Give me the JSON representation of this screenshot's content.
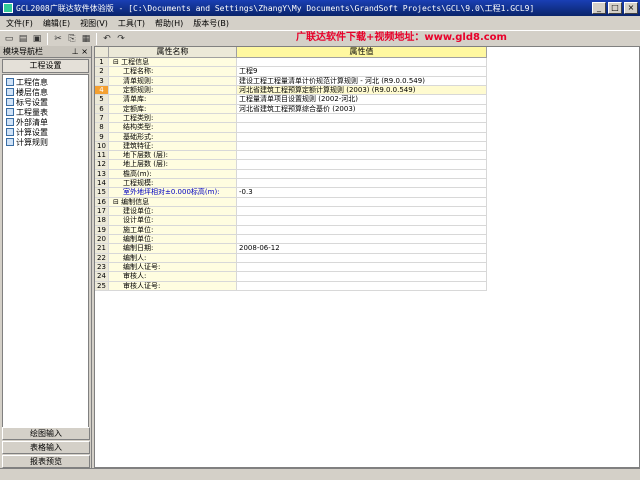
{
  "window": {
    "title": "GCL2008广联达软件体验版 - [C:\\Documents and Settings\\ZhangY\\My Documents\\GrandSoft Projects\\GCL\\9.0\\工程1.GCL9]",
    "minimize": "_",
    "maximize": "□",
    "close": "×"
  },
  "menu": [
    "文件(F)",
    "编辑(E)",
    "视图(V)",
    "工具(T)",
    "帮助(H)",
    "版本号(B)"
  ],
  "toolbar": {
    "icons": [
      "new-icon",
      "open-icon",
      "save-icon",
      "cut-icon",
      "copy-icon",
      "paste-icon",
      "undo-icon",
      "redo-icon"
    ],
    "glyphs": [
      "▭",
      "▤",
      "▣",
      "✂",
      "⎘",
      "▦",
      "↶",
      "↷"
    ]
  },
  "banner": "广联达软件下载+视频地址：www.gld8.com",
  "sidebar": {
    "title": "模块导航栏",
    "pin": "⊥ ×",
    "tab": "工程设置",
    "items": [
      "工程信息",
      "楼层信息",
      "标号设置",
      "工程量表",
      "外部清单",
      "计算设置",
      "计算规则"
    ],
    "bottom": [
      "绘图输入",
      "表格输入",
      "报表预览"
    ]
  },
  "grid": {
    "headers": [
      "",
      "属性名称",
      "属性值"
    ],
    "rows": [
      {
        "n": "1",
        "name": "⊟ 工程信息",
        "value": "",
        "group": true
      },
      {
        "n": "2",
        "name": "工程名称:",
        "value": "工程9"
      },
      {
        "n": "3",
        "name": "清单规则:",
        "value": "建设工程工程量清单计价规范计算规则 - 河北 (R9.0.0.549)"
      },
      {
        "n": "4",
        "name": "定额规则:",
        "value": "河北省建筑工程预算定额计算规则 (2003) (R9.0.0.549)",
        "hi": true
      },
      {
        "n": "5",
        "name": "清单库:",
        "value": "工程量清单项目设置规则 (2002-河北)"
      },
      {
        "n": "6",
        "name": "定额库:",
        "value": "河北省建筑工程预算综合基价 (2003)"
      },
      {
        "n": "7",
        "name": "工程类别:",
        "value": ""
      },
      {
        "n": "8",
        "name": "结构类型:",
        "value": ""
      },
      {
        "n": "9",
        "name": "基础形式:",
        "value": ""
      },
      {
        "n": "10",
        "name": "建筑特征:",
        "value": ""
      },
      {
        "n": "11",
        "name": "地下层数 (层):",
        "value": ""
      },
      {
        "n": "12",
        "name": "地上层数 (层):",
        "value": ""
      },
      {
        "n": "13",
        "name": "檐高(m):",
        "value": ""
      },
      {
        "n": "14",
        "name": "工程规模:",
        "value": ""
      },
      {
        "n": "15",
        "name": "室外地坪相对±0.000标高(m):",
        "value": "-0.3",
        "blue": true
      },
      {
        "n": "16",
        "name": "⊟ 编制信息",
        "value": "",
        "group": true
      },
      {
        "n": "17",
        "name": "建设单位:",
        "value": ""
      },
      {
        "n": "18",
        "name": "设计单位:",
        "value": ""
      },
      {
        "n": "19",
        "name": "施工单位:",
        "value": ""
      },
      {
        "n": "20",
        "name": "编制单位:",
        "value": ""
      },
      {
        "n": "21",
        "name": "编制日期:",
        "value": "2008-06-12"
      },
      {
        "n": "22",
        "name": "编制人:",
        "value": ""
      },
      {
        "n": "23",
        "name": "编制人证号:",
        "value": ""
      },
      {
        "n": "24",
        "name": "审核人:",
        "value": ""
      },
      {
        "n": "25",
        "name": "审核人证号:",
        "value": ""
      }
    ]
  }
}
